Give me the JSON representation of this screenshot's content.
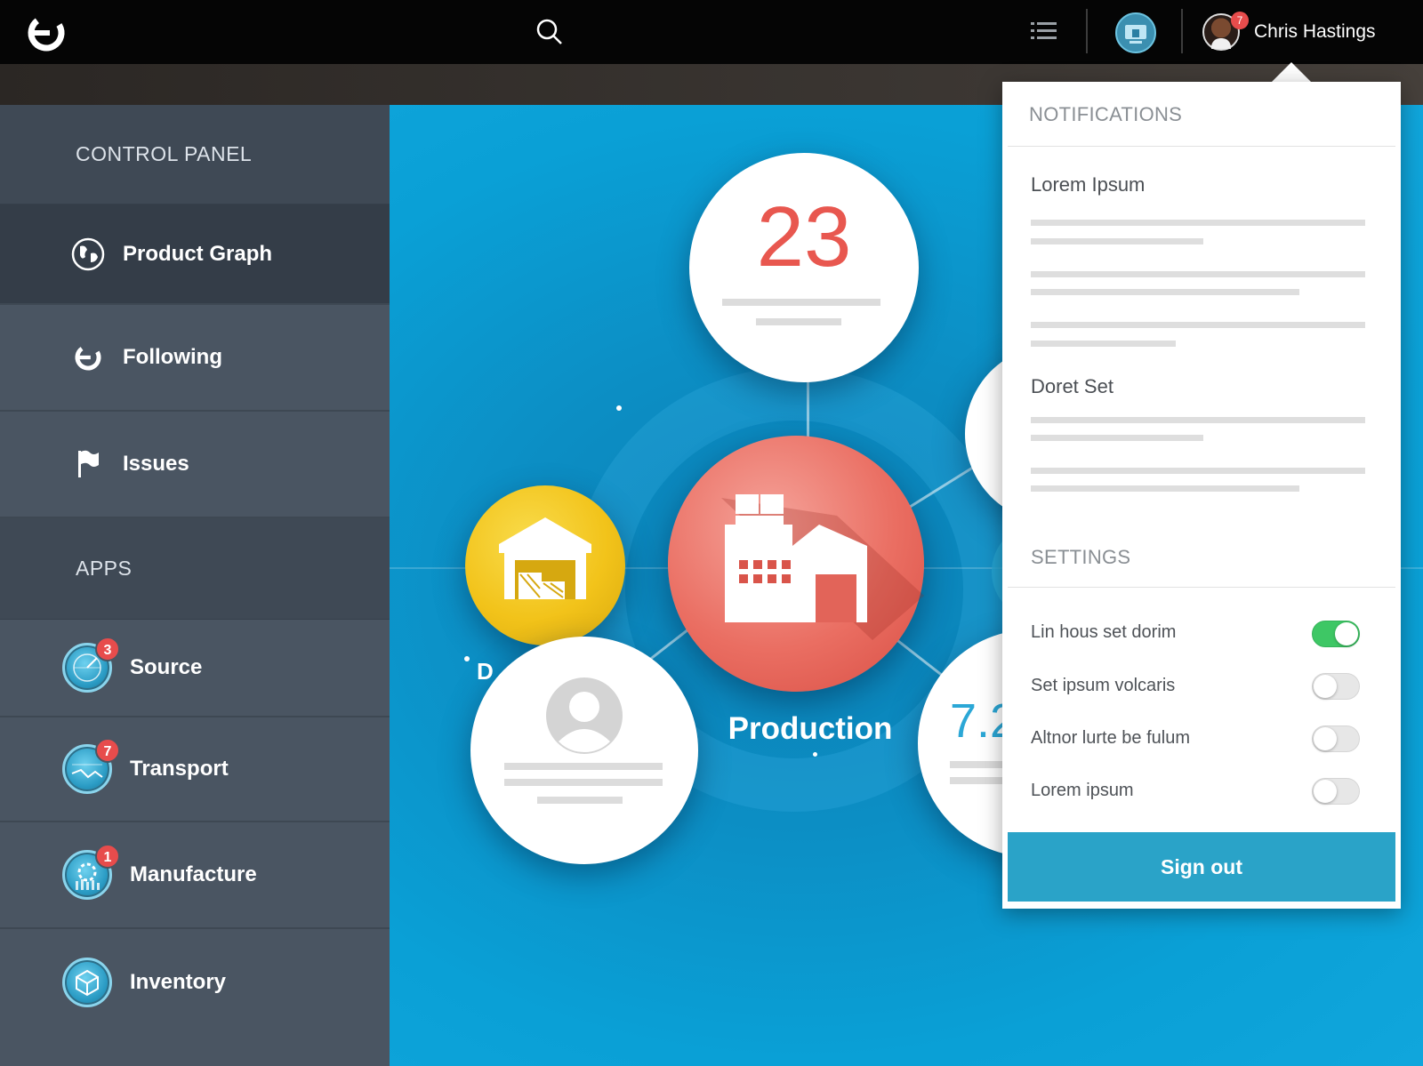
{
  "topbar": {
    "user_name": "Chris Hastings",
    "avatar_badge": "7",
    "icons": [
      "logo-icon",
      "search-icon",
      "list-icon",
      "device-icon",
      "avatar"
    ]
  },
  "sidebar": {
    "control_panel_title": "CONTROL PANEL",
    "items": [
      {
        "label": "Product Graph",
        "icon": "globe-icon",
        "active": true
      },
      {
        "label": "Following",
        "icon": "following-icon"
      },
      {
        "label": "Issues",
        "icon": "flag-icon"
      }
    ],
    "apps_title": "APPS",
    "apps": [
      {
        "label": "Source",
        "badge": "3",
        "icon": "radar-icon"
      },
      {
        "label": "Transport",
        "badge": "7",
        "icon": "route-icon"
      },
      {
        "label": "Manufacture",
        "badge": "1",
        "icon": "gear-icon"
      },
      {
        "label": "Inventory",
        "badge": "",
        "icon": "box-icon"
      }
    ]
  },
  "graph": {
    "top_value": "23",
    "center_label": "Production",
    "right_value": "7.2",
    "left_label_fragment": "D"
  },
  "dropdown": {
    "notifications_title": "NOTIFICATIONS",
    "notifications": [
      {
        "title": "Lorem Ipsum"
      },
      {
        "title": "Doret Set"
      }
    ],
    "settings_title": "SETTINGS",
    "settings": [
      {
        "label": "Lin hous set dorim",
        "on": true
      },
      {
        "label": "Set ipsum volcaris",
        "on": false
      },
      {
        "label": "Altnor lurte be fulum",
        "on": false
      },
      {
        "label": "Lorem ipsum",
        "on": false
      }
    ],
    "sign_out_label": "Sign out"
  },
  "colors": {
    "accent_blue": "#2aa3c8",
    "alert_red": "#e74c4c",
    "toggle_green": "#3ec765",
    "production_red": "#e8574f",
    "warehouse_yellow": "#f2c31a"
  }
}
